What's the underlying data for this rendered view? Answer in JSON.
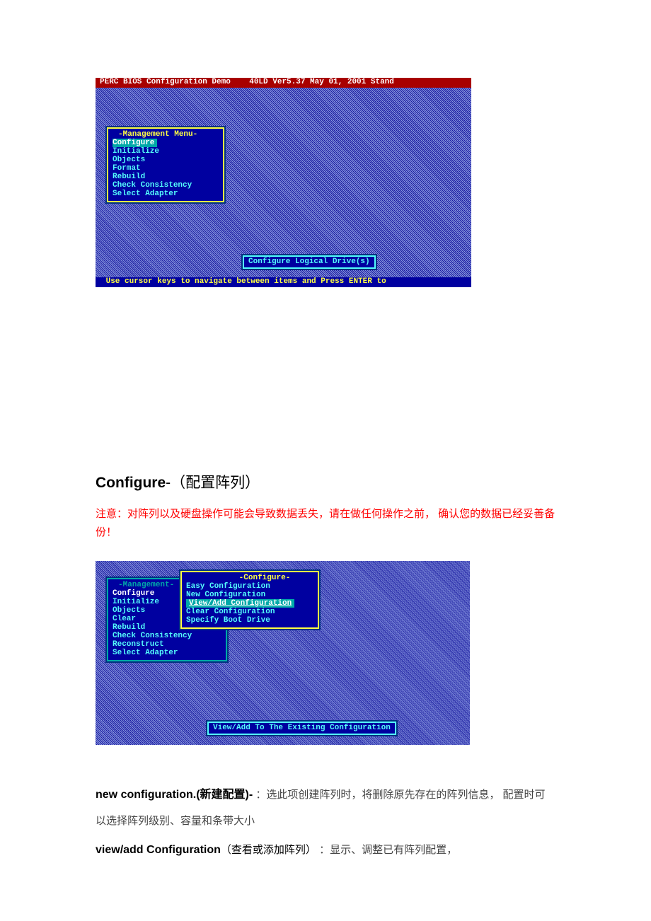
{
  "screenshot1": {
    "titlebar": "PERC BIOS Configuration Demo    40LD Ver5.37 May 01, 2001 Stand",
    "menu": {
      "title": "Management Menu",
      "items": [
        "Configure",
        "Initialize",
        "Objects",
        "Format",
        "Rebuild",
        "Check Consistency",
        "Select Adapter"
      ],
      "selected_index": 0
    },
    "hintbox": "Configure Logical Drive(s)",
    "footer": " Use cursor keys to navigate between items and Press ENTER to "
  },
  "section1": {
    "title_bold": "Configure",
    "title_sep": "-",
    "title_paren": "（配置阵列）",
    "warn": "注意：对阵列以及硬盘操作可能会导致数据丢失，请在做任何操作之前， 确认您的数据已经妥善备份！"
  },
  "screenshot2": {
    "left_menu": {
      "title": "Management",
      "items": [
        "Configure",
        "Initialize",
        "Objects",
        "Clear",
        "Rebuild",
        "Check Consistency",
        "Reconstruct",
        "Select Adapter"
      ],
      "selected_index": 0
    },
    "right_menu": {
      "title": "Configure",
      "items": [
        "Easy Configuration",
        "New Configuration",
        "View/Add Configuration",
        "Clear Configuration",
        "Specify Boot Drive"
      ],
      "selected_index": 2
    },
    "hintbox": "View/Add To The Existing Configuration"
  },
  "desc1": {
    "bold": "new configuration.(新建配置)-",
    "rest": "  ：选此项创建阵列时，将删除原先存在的阵列信息， 配置时可以选择阵列级别、容量和条带大小"
  },
  "desc2": {
    "bold": "view/add Configuration",
    "paren": "（查看或添加阵列）",
    "rest": " ：显示、调整已有阵列配置，"
  }
}
